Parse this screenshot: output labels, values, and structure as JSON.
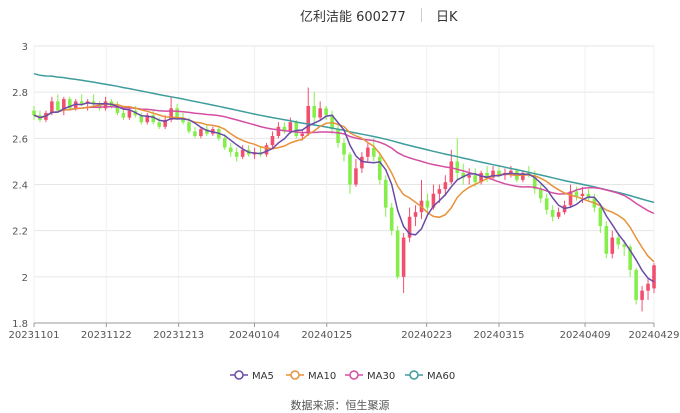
{
  "header": {
    "title": "亿利洁能 600277",
    "period": "日K"
  },
  "source": "数据来源：恒生聚源",
  "colors": {
    "up": "#f0506e",
    "down": "#86ee4a",
    "ma5": "#6a4ba8",
    "ma10": "#e8913a",
    "ma30": "#d44ea3",
    "ma60": "#3e9c9c",
    "grid": "#e6e6e6"
  },
  "chart_data": {
    "type": "candlestick",
    "y_ticks": [
      "3",
      "2.8",
      "2.6",
      "2.4",
      "2.2",
      "2",
      "1.8"
    ],
    "ylim": [
      1.8,
      3.0
    ],
    "x_ticks": [
      {
        "label": "20231101",
        "date": "2023-11-01"
      },
      {
        "label": "20231122",
        "date": "2023-11-22"
      },
      {
        "label": "20231213",
        "date": "2023-12-13"
      },
      {
        "label": "20240104",
        "date": "2024-01-04"
      },
      {
        "label": "20240125",
        "date": "2024-01-25"
      },
      {
        "label": "20240223",
        "date": "2024-02-23"
      },
      {
        "label": "20240315",
        "date": "2024-03-15"
      },
      {
        "label": "20240409",
        "date": "2024-04-09"
      },
      {
        "label": "20240429",
        "date": "2024-04-29"
      }
    ],
    "legend": [
      "MA5",
      "MA10",
      "MA30",
      "MA60"
    ],
    "candles": [
      {
        "o": 2.72,
        "h": 2.74,
        "l": 2.68,
        "c": 2.7
      },
      {
        "o": 2.7,
        "h": 2.72,
        "l": 2.67,
        "c": 2.68
      },
      {
        "o": 2.68,
        "h": 2.72,
        "l": 2.67,
        "c": 2.71
      },
      {
        "o": 2.71,
        "h": 2.78,
        "l": 2.7,
        "c": 2.76
      },
      {
        "o": 2.76,
        "h": 2.79,
        "l": 2.71,
        "c": 2.72
      },
      {
        "o": 2.72,
        "h": 2.78,
        "l": 2.7,
        "c": 2.77
      },
      {
        "o": 2.77,
        "h": 2.78,
        "l": 2.72,
        "c": 2.73
      },
      {
        "o": 2.73,
        "h": 2.77,
        "l": 2.72,
        "c": 2.76
      },
      {
        "o": 2.76,
        "h": 2.79,
        "l": 2.74,
        "c": 2.75
      },
      {
        "o": 2.75,
        "h": 2.77,
        "l": 2.72,
        "c": 2.76
      },
      {
        "o": 2.76,
        "h": 2.79,
        "l": 2.74,
        "c": 2.75
      },
      {
        "o": 2.75,
        "h": 2.76,
        "l": 2.72,
        "c": 2.73
      },
      {
        "o": 2.73,
        "h": 2.78,
        "l": 2.72,
        "c": 2.76
      },
      {
        "o": 2.76,
        "h": 2.77,
        "l": 2.73,
        "c": 2.74
      },
      {
        "o": 2.74,
        "h": 2.76,
        "l": 2.7,
        "c": 2.71
      },
      {
        "o": 2.71,
        "h": 2.73,
        "l": 2.68,
        "c": 2.69
      },
      {
        "o": 2.69,
        "h": 2.73,
        "l": 2.68,
        "c": 2.72
      },
      {
        "o": 2.72,
        "h": 2.74,
        "l": 2.69,
        "c": 2.7
      },
      {
        "o": 2.7,
        "h": 2.71,
        "l": 2.66,
        "c": 2.67
      },
      {
        "o": 2.67,
        "h": 2.71,
        "l": 2.66,
        "c": 2.7
      },
      {
        "o": 2.7,
        "h": 2.72,
        "l": 2.66,
        "c": 2.67
      },
      {
        "o": 2.67,
        "h": 2.69,
        "l": 2.64,
        "c": 2.65
      },
      {
        "o": 2.65,
        "h": 2.7,
        "l": 2.64,
        "c": 2.68
      },
      {
        "o": 2.68,
        "h": 2.78,
        "l": 2.67,
        "c": 2.73
      },
      {
        "o": 2.73,
        "h": 2.75,
        "l": 2.68,
        "c": 2.69
      },
      {
        "o": 2.69,
        "h": 2.71,
        "l": 2.66,
        "c": 2.67
      },
      {
        "o": 2.67,
        "h": 2.69,
        "l": 2.62,
        "c": 2.63
      },
      {
        "o": 2.63,
        "h": 2.65,
        "l": 2.6,
        "c": 2.61
      },
      {
        "o": 2.61,
        "h": 2.65,
        "l": 2.6,
        "c": 2.64
      },
      {
        "o": 2.64,
        "h": 2.66,
        "l": 2.61,
        "c": 2.62
      },
      {
        "o": 2.62,
        "h": 2.65,
        "l": 2.61,
        "c": 2.64
      },
      {
        "o": 2.64,
        "h": 2.65,
        "l": 2.59,
        "c": 2.6
      },
      {
        "o": 2.6,
        "h": 2.62,
        "l": 2.55,
        "c": 2.56
      },
      {
        "o": 2.56,
        "h": 2.58,
        "l": 2.52,
        "c": 2.54
      },
      {
        "o": 2.54,
        "h": 2.56,
        "l": 2.5,
        "c": 2.52
      },
      {
        "o": 2.52,
        "h": 2.57,
        "l": 2.51,
        "c": 2.55
      },
      {
        "o": 2.55,
        "h": 2.57,
        "l": 2.52,
        "c": 2.53
      },
      {
        "o": 2.53,
        "h": 2.56,
        "l": 2.51,
        "c": 2.54
      },
      {
        "o": 2.54,
        "h": 2.56,
        "l": 2.52,
        "c": 2.53
      },
      {
        "o": 2.53,
        "h": 2.58,
        "l": 2.52,
        "c": 2.57
      },
      {
        "o": 2.57,
        "h": 2.63,
        "l": 2.56,
        "c": 2.61
      },
      {
        "o": 2.61,
        "h": 2.67,
        "l": 2.6,
        "c": 2.65
      },
      {
        "o": 2.65,
        "h": 2.67,
        "l": 2.62,
        "c": 2.63
      },
      {
        "o": 2.63,
        "h": 2.69,
        "l": 2.62,
        "c": 2.67
      },
      {
        "o": 2.67,
        "h": 2.68,
        "l": 2.6,
        "c": 2.61
      },
      {
        "o": 2.61,
        "h": 2.64,
        "l": 2.59,
        "c": 2.62
      },
      {
        "o": 2.62,
        "h": 2.82,
        "l": 2.61,
        "c": 2.74
      },
      {
        "o": 2.74,
        "h": 2.8,
        "l": 2.66,
        "c": 2.69
      },
      {
        "o": 2.69,
        "h": 2.76,
        "l": 2.68,
        "c": 2.73
      },
      {
        "o": 2.73,
        "h": 2.74,
        "l": 2.68,
        "c": 2.7
      },
      {
        "o": 2.7,
        "h": 2.72,
        "l": 2.62,
        "c": 2.64
      },
      {
        "o": 2.64,
        "h": 2.66,
        "l": 2.56,
        "c": 2.58
      },
      {
        "o": 2.58,
        "h": 2.6,
        "l": 2.5,
        "c": 2.53
      },
      {
        "o": 2.53,
        "h": 2.54,
        "l": 2.36,
        "c": 2.4
      },
      {
        "o": 2.4,
        "h": 2.51,
        "l": 2.39,
        "c": 2.47
      },
      {
        "o": 2.47,
        "h": 2.54,
        "l": 2.45,
        "c": 2.52
      },
      {
        "o": 2.52,
        "h": 2.58,
        "l": 2.5,
        "c": 2.56
      },
      {
        "o": 2.56,
        "h": 2.6,
        "l": 2.5,
        "c": 2.52
      },
      {
        "o": 2.52,
        "h": 2.53,
        "l": 2.4,
        "c": 2.42
      },
      {
        "o": 2.42,
        "h": 2.44,
        "l": 2.26,
        "c": 2.3
      },
      {
        "o": 2.3,
        "h": 2.32,
        "l": 2.18,
        "c": 2.2
      },
      {
        "o": 2.2,
        "h": 2.22,
        "l": 1.99,
        "c": 2.0
      },
      {
        "o": 2.0,
        "h": 2.19,
        "l": 1.93,
        "c": 2.17
      },
      {
        "o": 2.17,
        "h": 2.3,
        "l": 2.15,
        "c": 2.26
      },
      {
        "o": 2.26,
        "h": 2.31,
        "l": 2.22,
        "c": 2.28
      },
      {
        "o": 2.28,
        "h": 2.42,
        "l": 2.25,
        "c": 2.33
      },
      {
        "o": 2.33,
        "h": 2.36,
        "l": 2.28,
        "c": 2.3
      },
      {
        "o": 2.3,
        "h": 2.4,
        "l": 2.29,
        "c": 2.36
      },
      {
        "o": 2.36,
        "h": 2.4,
        "l": 2.32,
        "c": 2.38
      },
      {
        "o": 2.38,
        "h": 2.44,
        "l": 2.35,
        "c": 2.41
      },
      {
        "o": 2.41,
        "h": 2.55,
        "l": 2.4,
        "c": 2.5
      },
      {
        "o": 2.5,
        "h": 2.6,
        "l": 2.42,
        "c": 2.45
      },
      {
        "o": 2.45,
        "h": 2.49,
        "l": 2.4,
        "c": 2.43
      },
      {
        "o": 2.43,
        "h": 2.47,
        "l": 2.4,
        "c": 2.44
      },
      {
        "o": 2.44,
        "h": 2.47,
        "l": 2.39,
        "c": 2.41
      },
      {
        "o": 2.41,
        "h": 2.46,
        "l": 2.4,
        "c": 2.45
      },
      {
        "o": 2.45,
        "h": 2.48,
        "l": 2.41,
        "c": 2.43
      },
      {
        "o": 2.43,
        "h": 2.48,
        "l": 2.42,
        "c": 2.46
      },
      {
        "o": 2.46,
        "h": 2.48,
        "l": 2.43,
        "c": 2.44
      },
      {
        "o": 2.44,
        "h": 2.47,
        "l": 2.42,
        "c": 2.45
      },
      {
        "o": 2.45,
        "h": 2.48,
        "l": 2.43,
        "c": 2.46
      },
      {
        "o": 2.46,
        "h": 2.47,
        "l": 2.41,
        "c": 2.42
      },
      {
        "o": 2.42,
        "h": 2.46,
        "l": 2.41,
        "c": 2.45
      },
      {
        "o": 2.45,
        "h": 2.48,
        "l": 2.43,
        "c": 2.44
      },
      {
        "o": 2.44,
        "h": 2.46,
        "l": 2.36,
        "c": 2.38
      },
      {
        "o": 2.38,
        "h": 2.4,
        "l": 2.32,
        "c": 2.34
      },
      {
        "o": 2.34,
        "h": 2.36,
        "l": 2.27,
        "c": 2.29
      },
      {
        "o": 2.29,
        "h": 2.31,
        "l": 2.24,
        "c": 2.26
      },
      {
        "o": 2.26,
        "h": 2.3,
        "l": 2.25,
        "c": 2.28
      },
      {
        "o": 2.28,
        "h": 2.33,
        "l": 2.27,
        "c": 2.31
      },
      {
        "o": 2.31,
        "h": 2.4,
        "l": 2.3,
        "c": 2.37
      },
      {
        "o": 2.37,
        "h": 2.39,
        "l": 2.33,
        "c": 2.35
      },
      {
        "o": 2.35,
        "h": 2.39,
        "l": 2.32,
        "c": 2.36
      },
      {
        "o": 2.36,
        "h": 2.38,
        "l": 2.33,
        "c": 2.34
      },
      {
        "o": 2.34,
        "h": 2.36,
        "l": 2.28,
        "c": 2.3
      },
      {
        "o": 2.3,
        "h": 2.31,
        "l": 2.19,
        "c": 2.22
      },
      {
        "o": 2.22,
        "h": 2.24,
        "l": 2.08,
        "c": 2.1
      },
      {
        "o": 2.1,
        "h": 2.2,
        "l": 2.08,
        "c": 2.17
      },
      {
        "o": 2.17,
        "h": 2.19,
        "l": 2.12,
        "c": 2.14
      },
      {
        "o": 2.14,
        "h": 2.16,
        "l": 2.09,
        "c": 2.13
      },
      {
        "o": 2.13,
        "h": 2.14,
        "l": 2.0,
        "c": 2.03
      },
      {
        "o": 2.03,
        "h": 2.04,
        "l": 1.88,
        "c": 1.9
      },
      {
        "o": 1.9,
        "h": 1.96,
        "l": 1.85,
        "c": 1.94
      },
      {
        "o": 1.94,
        "h": 1.99,
        "l": 1.9,
        "c": 1.97
      },
      {
        "o": 1.95,
        "h": 2.06,
        "l": 1.93,
        "c": 2.05
      }
    ],
    "ma60": [
      2.94,
      2.31
    ]
  }
}
